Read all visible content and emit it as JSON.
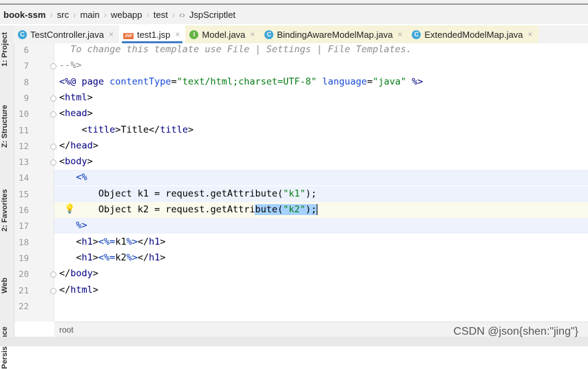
{
  "breadcrumb": [
    "book-ssm",
    "src",
    "main",
    "webapp",
    "test",
    "JspScriptlet"
  ],
  "tabs": [
    {
      "label": "TestController.java",
      "icon": "C",
      "kind": "c"
    },
    {
      "label": "test1.jsp",
      "icon": "JSP",
      "kind": "jsp",
      "active": true
    },
    {
      "label": "Model.java",
      "icon": "I",
      "kind": "i"
    },
    {
      "label": "BindingAwareModelMap.java",
      "icon": "C",
      "kind": "c"
    },
    {
      "label": "ExtendedModelMap.java",
      "icon": "C",
      "kind": "c"
    }
  ],
  "sidebar": [
    "1: Project",
    "Z: Structure",
    "2: Favorites",
    "Web",
    "Persistence"
  ],
  "lines": [
    {
      "n": "6",
      "t": [
        [
          "  To change this template use File | Settings | File Templates.",
          "cm"
        ]
      ]
    },
    {
      "n": "7",
      "t": [
        [
          "--%>",
          "cm"
        ]
      ]
    },
    {
      "n": "8",
      "t": [
        [
          "<%@ ",
          "dir"
        ],
        [
          "page ",
          "tag"
        ],
        [
          "contentType",
          "attr"
        ],
        [
          "=",
          ""
        ],
        [
          "\"text/html;charset=UTF-8\"",
          "str"
        ],
        [
          " language",
          "attr"
        ],
        [
          "=",
          ""
        ],
        [
          "\"java\"",
          "str"
        ],
        [
          " %>",
          "dir"
        ]
      ]
    },
    {
      "n": "9",
      "t": [
        [
          "<",
          ""
        ],
        [
          "html",
          "tag"
        ],
        [
          ">",
          ""
        ]
      ]
    },
    {
      "n": "10",
      "t": [
        [
          "<",
          ""
        ],
        [
          "head",
          "tag"
        ],
        [
          ">",
          ""
        ]
      ]
    },
    {
      "n": "11",
      "t": [
        [
          "    <",
          ""
        ],
        [
          "title",
          "tag"
        ],
        [
          ">Title</",
          ""
        ],
        [
          "title",
          "tag"
        ],
        [
          ">",
          ""
        ]
      ]
    },
    {
      "n": "12",
      "t": [
        [
          "</",
          ""
        ],
        [
          "head",
          "tag"
        ],
        [
          ">",
          ""
        ]
      ]
    },
    {
      "n": "13",
      "t": [
        [
          "<",
          ""
        ],
        [
          "body",
          "tag"
        ],
        [
          ">",
          ""
        ]
      ]
    },
    {
      "n": "14",
      "t": [
        [
          "   <%",
          "pct"
        ]
      ]
    },
    {
      "n": "15",
      "t": [
        [
          "       Object k1 = request.getAttribute(",
          ""
        ],
        [
          "\"k1\"",
          "str"
        ],
        [
          ");",
          ""
        ]
      ]
    },
    {
      "n": "16",
      "t": [
        [
          "       Object k2 = request.getAttri",
          ""
        ],
        [
          "bute(",
          "sel"
        ],
        [
          "\"k2\"",
          "str sel"
        ],
        [
          ");",
          "sel"
        ]
      ]
    },
    {
      "n": "17",
      "t": [
        [
          "   %>",
          "pct"
        ]
      ]
    },
    {
      "n": "18",
      "t": [
        [
          "   <",
          ""
        ],
        [
          "h1",
          "tag"
        ],
        [
          ">",
          ""
        ],
        [
          "<%=",
          "pct"
        ],
        [
          "k1",
          ""
        ],
        [
          "%>",
          "pct"
        ],
        [
          "</",
          ""
        ],
        [
          "h1",
          "tag"
        ],
        [
          ">",
          ""
        ]
      ]
    },
    {
      "n": "19",
      "t": [
        [
          "   <",
          ""
        ],
        [
          "h1",
          "tag"
        ],
        [
          ">",
          ""
        ],
        [
          "<%=",
          "pct"
        ],
        [
          "k2",
          ""
        ],
        [
          "%>",
          "pct"
        ],
        [
          "</",
          ""
        ],
        [
          "h1",
          "tag"
        ],
        [
          ">",
          ""
        ]
      ]
    },
    {
      "n": "20",
      "t": [
        [
          "</",
          ""
        ],
        [
          "body",
          "tag"
        ],
        [
          ">",
          ""
        ]
      ]
    },
    {
      "n": "21",
      "t": [
        [
          "</",
          ""
        ],
        [
          "html",
          "tag"
        ],
        [
          ">",
          ""
        ]
      ]
    },
    {
      "n": "22",
      "t": []
    }
  ],
  "status": {
    "crumb": "root"
  },
  "watermark": "CSDN @json{shen:\"jing\"}"
}
